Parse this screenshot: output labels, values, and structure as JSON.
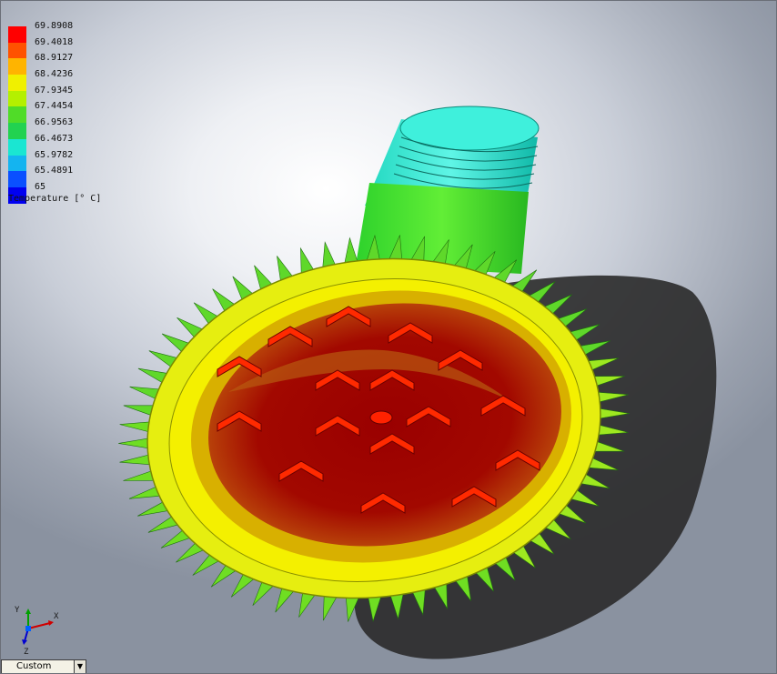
{
  "legend": {
    "title": "Temperature [° C]",
    "ticks": [
      "69.8908",
      "69.4018",
      "68.9127",
      "68.4236",
      "67.9345",
      "67.4454",
      "66.9563",
      "66.4673",
      "65.9782",
      "65.4891",
      "65"
    ],
    "colors": [
      "#ff0000",
      "#ff5200",
      "#ffb400",
      "#f0f000",
      "#b4f000",
      "#50dc28",
      "#22d250",
      "#1ae6d2",
      "#14b4f0",
      "#0a50ff",
      "#0000f0"
    ]
  },
  "model": {
    "name_icon": "led-lamp-heatsink-model",
    "colors": {
      "hot_core": "#9a0000",
      "hot_pad": "#ff1a00",
      "warm": "#f0b400",
      "rim": "#f0f000",
      "fins": "#6ee01a",
      "neck_green": "#52e02a",
      "neck_cyan": "#22e6c8"
    }
  },
  "triad": {
    "x_label": "X",
    "y_label": "Y",
    "z_label": "Z"
  },
  "view": {
    "selected": "Custom"
  }
}
